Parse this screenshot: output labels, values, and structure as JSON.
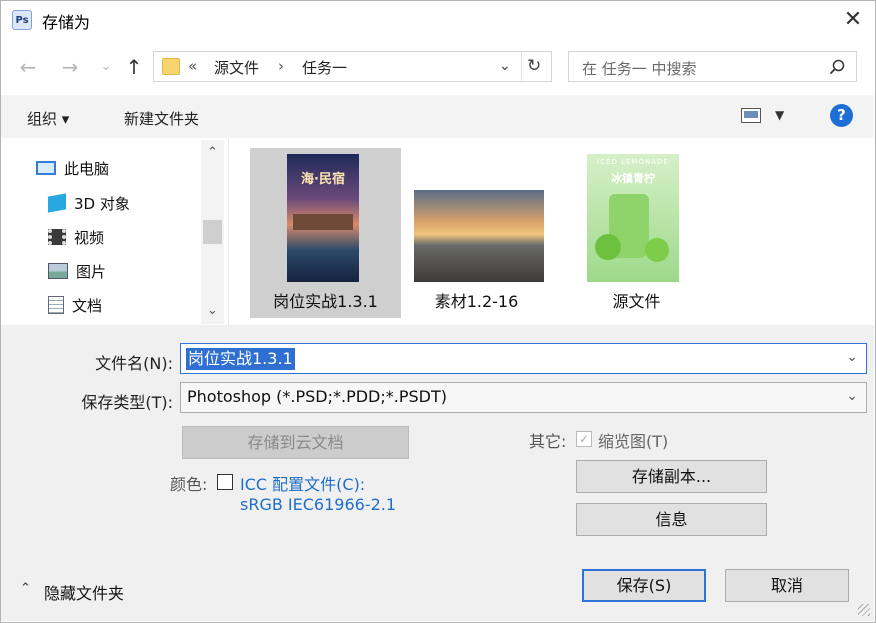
{
  "window": {
    "title": "存储为",
    "app_icon": "Ps"
  },
  "nav": {
    "back_icon": "←",
    "forward_icon": "→",
    "recent_icon": "⌄",
    "up_icon": "↑",
    "address": {
      "prefix": "«",
      "crumbs": [
        "源文件",
        "任务一"
      ],
      "separator": "›"
    },
    "search_placeholder": "在 任务一 中搜索"
  },
  "toolbar": {
    "organize": "组织 ▾",
    "new_folder": "新建文件夹"
  },
  "tree": [
    {
      "label": "此电脑",
      "icon": "pc-icon"
    },
    {
      "label": "3D 对象",
      "icon": "3d-objects-icon"
    },
    {
      "label": "视频",
      "icon": "video-icon"
    },
    {
      "label": "图片",
      "icon": "pictures-icon"
    },
    {
      "label": "文档",
      "icon": "documents-icon"
    }
  ],
  "files": [
    {
      "name": "岗位实战1.3.1",
      "thumb_title": "海·民宿",
      "selected": true
    },
    {
      "name": "素材1.2-16",
      "selected": false
    },
    {
      "name": "源文件",
      "thumb_title": "冰镇青柠",
      "thumb_header": "ICED LEMONADE",
      "selected": false
    }
  ],
  "form": {
    "filename_label": "文件名(N):",
    "filename_value": "岗位实战1.3.1",
    "filetype_label": "保存类型(T):",
    "filetype_value": "Photoshop (*.PSD;*.PDD;*.PSDT)",
    "cloud_button": "存储到云文档",
    "color_label": "颜色:",
    "icc_line1": "ICC 配置文件(C):",
    "icc_line2": "sRGB IEC61966-2.1",
    "other_label": "其它:",
    "thumbnail_label": "缩览图(T)",
    "save_copy_button": "存储副本...",
    "info_button": "信息",
    "hide_folders": "隐藏文件夹",
    "save_button": "保存(S)",
    "cancel_button": "取消"
  },
  "colors": {
    "accent": "#2f73d8",
    "selection": "#2f6fd1",
    "link": "#1e6ec8"
  }
}
